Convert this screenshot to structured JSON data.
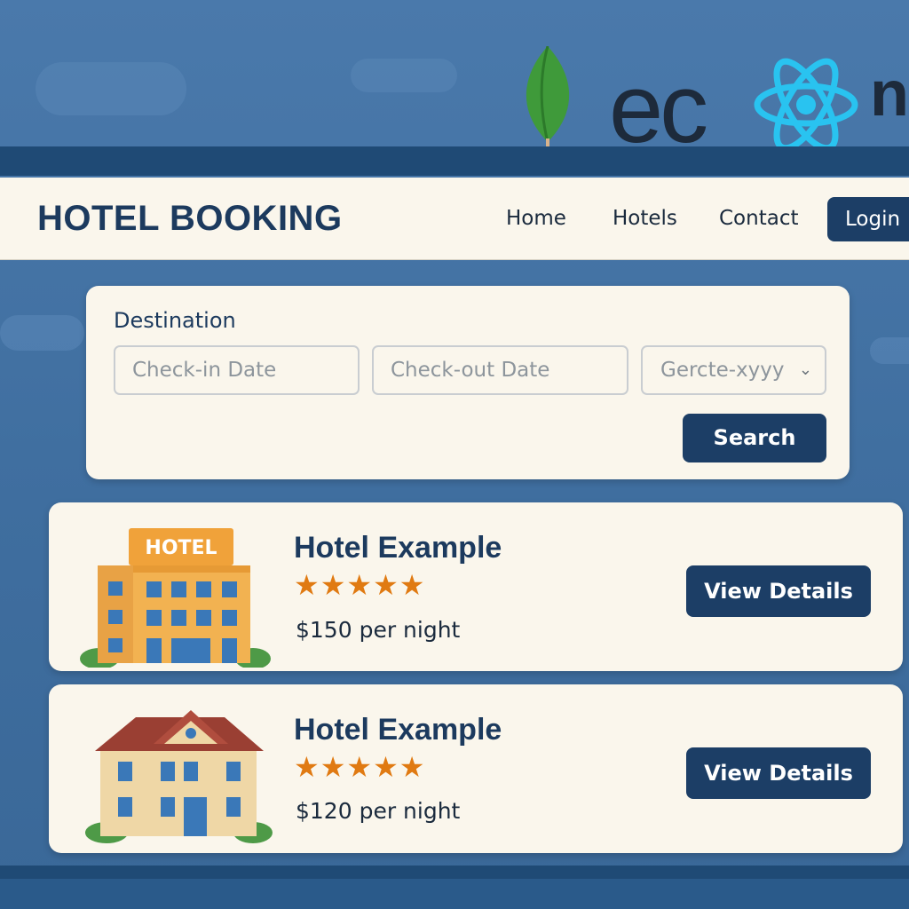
{
  "header": {
    "brand": "HOTEL BOOKING",
    "tech_logos": {
      "mongodb_icon": "leaf-icon",
      "express_text": "ec",
      "react_icon": "react-icon",
      "node_text": "n"
    },
    "nav": [
      "Home",
      "Hotels",
      "Contact"
    ],
    "login_label": "Login"
  },
  "search": {
    "destination_label": "Destination",
    "checkin_placeholder": "Check-in Date",
    "checkout_placeholder": "Check-out Date",
    "select_value": "Gercte-xyyy",
    "search_label": "Search"
  },
  "hotels": [
    {
      "name": "Hotel Example",
      "stars": "★★★★★",
      "rating": 5,
      "price": "$150 per night",
      "button": "View Details",
      "image": "hotel-building-icon",
      "sign": "HOTEL"
    },
    {
      "name": "Hotel Example",
      "stars": "★★★★★",
      "rating": 5,
      "price": "$120 per night",
      "button": "View Details",
      "image": "house-hotel-icon"
    }
  ],
  "colors": {
    "background": "#4a79ab",
    "navy": "#1c3e66",
    "card": "#faf6ec",
    "star": "#e07a12"
  }
}
